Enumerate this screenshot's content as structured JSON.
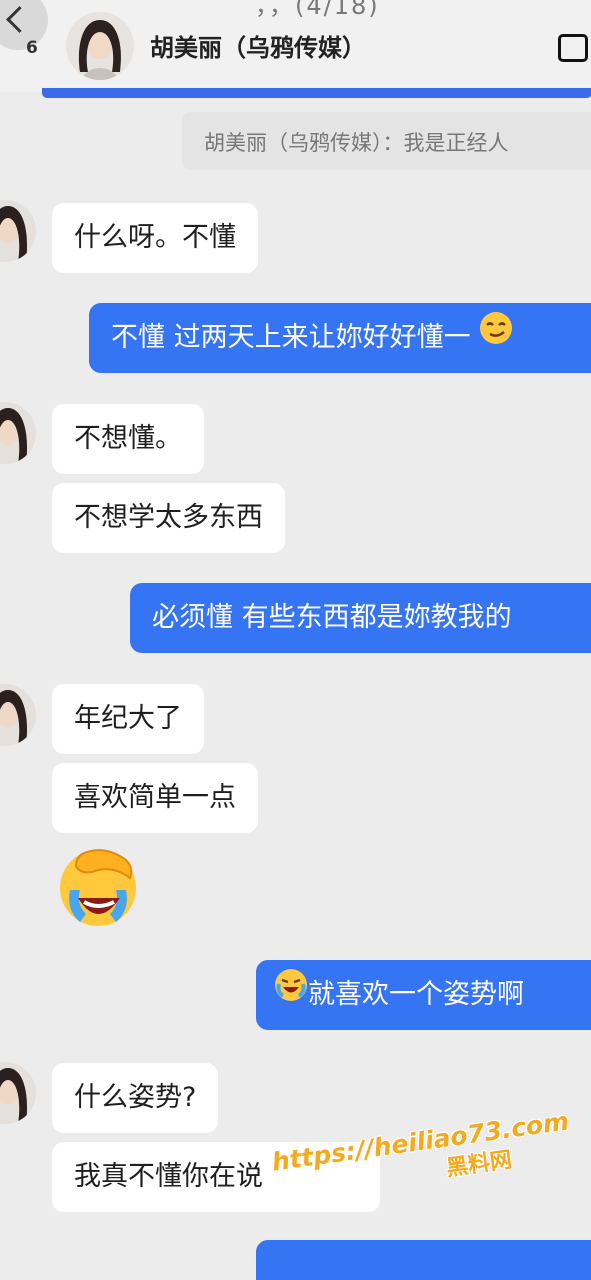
{
  "header": {
    "status_fragment": "，，(4/18)",
    "unread_count": "6",
    "title": "胡美丽（乌鸦传媒）"
  },
  "quote": {
    "text": "胡美丽（乌鸦传媒）：我是正经人"
  },
  "messages": [
    {
      "side": "in",
      "text": "什么呀。不懂"
    },
    {
      "side": "out",
      "text": "不懂 过两天上来让妳好好懂一",
      "emoji": "smirk-emoji"
    },
    {
      "side": "in",
      "text": "不想懂。"
    },
    {
      "side": "in",
      "text": "不想学太多东西"
    },
    {
      "side": "out",
      "text": "必须懂 有些东西都是妳教我的"
    },
    {
      "side": "in",
      "text": "年纪大了"
    },
    {
      "side": "in",
      "text": "喜欢简单一点"
    },
    {
      "side": "in",
      "emoji": "facepalm-crying-emoji"
    },
    {
      "side": "out",
      "text": "就喜欢一个姿势啊",
      "emoji": "laugh-crying-emoji"
    },
    {
      "side": "in",
      "text": "什么姿势?"
    },
    {
      "side": "in",
      "text": "我真不懂你在说"
    },
    {
      "side": "out",
      "text": ""
    }
  ],
  "watermark": {
    "url": "https://heiliao73.com",
    "label": "黑料网"
  },
  "colors": {
    "outgoing_bubble": "#3574f2",
    "incoming_bubble": "#ffffff",
    "background": "#ececec",
    "watermark": "#f5a91d"
  }
}
